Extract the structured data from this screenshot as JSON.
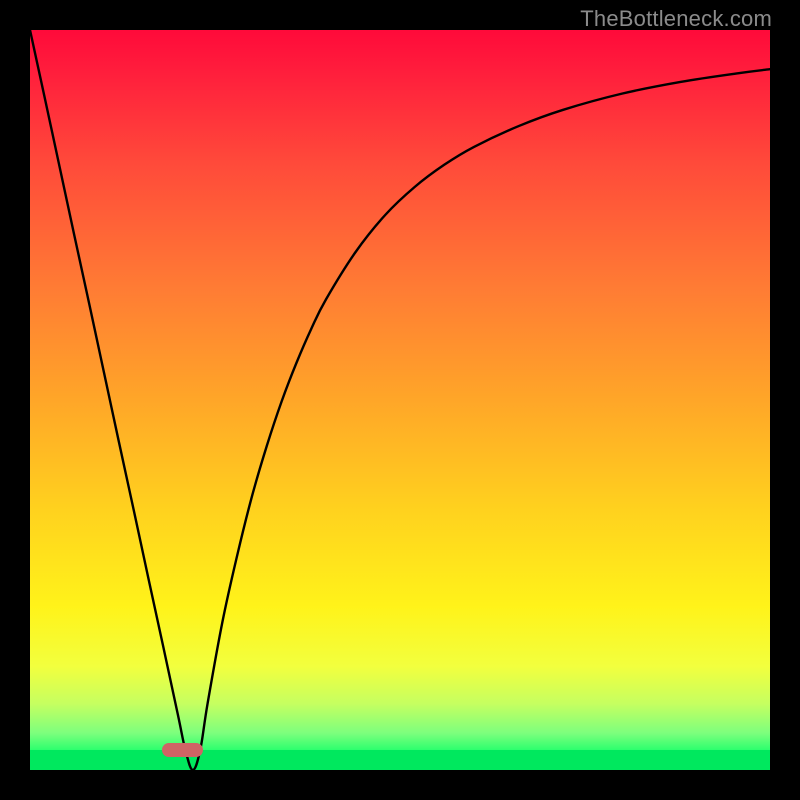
{
  "watermark": "TheBottleneck.com",
  "gradient": {
    "top": "#ff0a3a",
    "mid": "#ffd21e",
    "bottom_band": "#00e85e"
  },
  "marker": {
    "x_frac": 0.206,
    "width_frac": 0.055,
    "y_frac": 0.973,
    "height_frac": 0.018,
    "color": "#cf6465"
  },
  "chart_data": {
    "type": "line",
    "title": "",
    "xlabel": "",
    "ylabel": "",
    "xlim": [
      0,
      100
    ],
    "ylim": [
      0,
      100
    ],
    "x": [
      0,
      2,
      4,
      6,
      8,
      10,
      12,
      14,
      16,
      18,
      20,
      21,
      22,
      23,
      24,
      26,
      28,
      30,
      32,
      34,
      36,
      38,
      40,
      44,
      48,
      52,
      56,
      60,
      66,
      72,
      80,
      88,
      96,
      100
    ],
    "y": [
      100,
      90.8,
      81.5,
      72.2,
      63.0,
      53.7,
      44.4,
      35.2,
      25.9,
      16.7,
      7.4,
      2.7,
      0.0,
      2.7,
      9.0,
      20.0,
      29.0,
      37.0,
      43.8,
      49.8,
      55.0,
      59.6,
      63.6,
      70.0,
      75.0,
      78.8,
      81.8,
      84.2,
      87.0,
      89.2,
      91.4,
      93.0,
      94.2,
      94.7
    ],
    "annotations": [
      {
        "kind": "minimum_marker",
        "x": 22,
        "y": 0
      }
    ],
    "gradient_stops": [
      {
        "pos": 0.0,
        "color": "#ff0a3a"
      },
      {
        "pos": 0.5,
        "color": "#ffa628"
      },
      {
        "pos": 0.78,
        "color": "#fff31a"
      },
      {
        "pos": 0.95,
        "color": "#7dff7d"
      },
      {
        "pos": 1.0,
        "color": "#00e85e"
      }
    ]
  }
}
